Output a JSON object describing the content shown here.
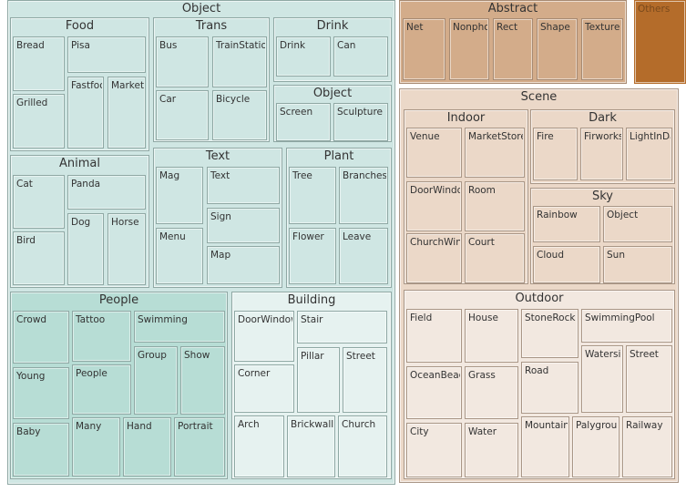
{
  "chart_data": {
    "type": "treemap",
    "title": "",
    "colors": {
      "object": "#cfe6e3",
      "people": "#b7ddd5",
      "building": "#e6f2f0",
      "abstract": "#d3ac8a",
      "others": "#b46c2a",
      "scene": "#ebd8c8",
      "outdoor": "#f2e8e0"
    },
    "root": [
      {
        "id": "object",
        "label": "Object",
        "children": [
          {
            "id": "food",
            "label": "Food",
            "children": [
              "Bread",
              "Pisa",
              "Grilled",
              "Fastfoo",
              "Market"
            ]
          },
          {
            "id": "trans",
            "label": "Trans",
            "children": [
              "Bus",
              "TrainStation",
              "Car",
              "Bicycle"
            ]
          },
          {
            "id": "drink",
            "label": "Drink",
            "children": [
              "Drink",
              "Can"
            ]
          },
          {
            "id": "object2",
            "label": "Object",
            "children": [
              "Screen",
              "Sculpture"
            ]
          },
          {
            "id": "animal",
            "label": "Animal",
            "children": [
              "Cat",
              "Panda",
              "Bird",
              "Dog",
              "Horse"
            ]
          },
          {
            "id": "text",
            "label": "Text",
            "children": [
              "Mag",
              "Text",
              "Sign",
              "Menu",
              "Map"
            ]
          },
          {
            "id": "plant",
            "label": "Plant",
            "children": [
              "Tree",
              "Branches",
              "Flower",
              "Leave"
            ]
          },
          {
            "id": "people",
            "label": "People",
            "children": [
              "Crowd",
              "Tattoo",
              "Swimming",
              "Group",
              "Show",
              "Young",
              "People",
              "Baby",
              "Many",
              "Hand",
              "Portrait"
            ]
          },
          {
            "id": "building",
            "label": "Building",
            "children": [
              "DoorWindow",
              "Stair",
              "Pillar",
              "Street",
              "Corner",
              "Arch",
              "Brickwall",
              "Church"
            ]
          }
        ]
      },
      {
        "id": "abstract",
        "label": "Abstract",
        "children": [
          "Net",
          "Nonphot",
          "Rect",
          "Shape",
          "Texture"
        ]
      },
      {
        "id": "others",
        "label": "Others",
        "children": []
      },
      {
        "id": "scene",
        "label": "Scene",
        "children": [
          {
            "id": "indoor",
            "label": "Indoor",
            "children": [
              "Venue",
              "MarketStore",
              "DoorWindow",
              "Room",
              "ChurchWind",
              "Court"
            ]
          },
          {
            "id": "dark",
            "label": "Dark",
            "children": [
              "Fire",
              "Firworks",
              "LightInDa"
            ]
          },
          {
            "id": "sky",
            "label": "Sky",
            "children": [
              "Rainbow",
              "Object",
              "Cloud",
              "Sun"
            ]
          },
          {
            "id": "outdoor",
            "label": "Outdoor",
            "children": [
              "Field",
              "House",
              "StoneRock",
              "SwimmingPool",
              "Watersid",
              "Street",
              "OceanBeach",
              "Grass",
              "Road",
              "City",
              "Water",
              "Mountain",
              "Palygroun",
              "Railway"
            ]
          }
        ]
      }
    ]
  }
}
